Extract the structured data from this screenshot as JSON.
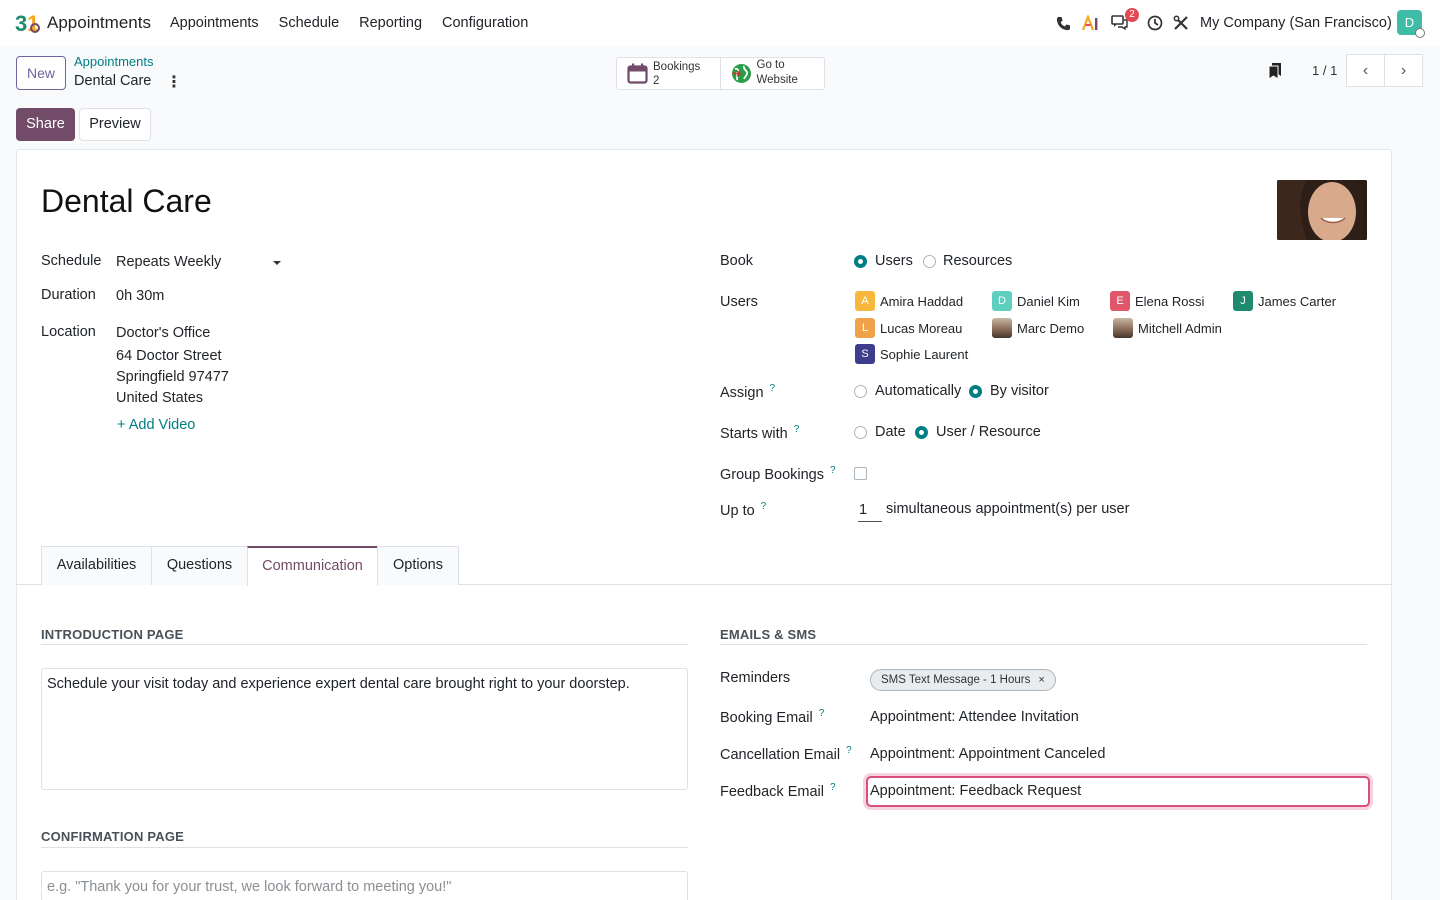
{
  "navbar": {
    "app_name": "Appointments",
    "menu": [
      "Appointments",
      "Schedule",
      "Reporting",
      "Configuration"
    ],
    "message_count": "2",
    "company": "My Company (San Francisco)",
    "user_initial": "D"
  },
  "control": {
    "new_label": "New",
    "breadcrumb_parent": "Appointments",
    "breadcrumb_current": "Dental Care",
    "bookings_label": "Bookings",
    "bookings_count": "2",
    "website_label_1": "Go to",
    "website_label_2": "Website",
    "pager": "1 / 1",
    "share_label": "Share",
    "preview_label": "Preview"
  },
  "form": {
    "title": "Dental Care",
    "schedule_label": "Schedule",
    "schedule_value": "Repeats Weekly",
    "duration_label": "Duration",
    "duration_value": "0h 30m",
    "location_label": "Location",
    "location_lines": [
      "Doctor's Office",
      "64 Doctor Street",
      "Springfield 97477",
      "United States"
    ],
    "add_video": "Add Video",
    "book_label": "Book",
    "book_options": [
      "Users",
      "Resources"
    ],
    "users_label": "Users",
    "users": [
      {
        "initial": "A",
        "name": "Amira Haddad",
        "color": "#f6b73c"
      },
      {
        "initial": "D",
        "name": "Daniel Kim",
        "color": "#5fcfc0"
      },
      {
        "initial": "E",
        "name": "Elena Rossi",
        "color": "#e0566a"
      },
      {
        "initial": "J",
        "name": "James Carter",
        "color": "#1e8a6e"
      },
      {
        "initial": "L",
        "name": "Lucas Moreau",
        "color": "#f0a24a"
      },
      {
        "initial": "",
        "name": "Marc Demo",
        "color": "photo"
      },
      {
        "initial": "",
        "name": "Mitchell Admin",
        "color": "photo"
      },
      {
        "initial": "S",
        "name": "Sophie Laurent",
        "color": "#3e3d8c"
      }
    ],
    "assign_label": "Assign",
    "assign_options": [
      "Automatically",
      "By visitor"
    ],
    "starts_label": "Starts with",
    "starts_options": [
      "Date",
      "User / Resource"
    ],
    "group_label": "Group Bookings",
    "upto_label": "Up to",
    "upto_value": "1",
    "upto_suffix": "simultaneous appointment(s) per user",
    "help": "?"
  },
  "tabs": [
    "Availabilities",
    "Questions",
    "Communication",
    "Options"
  ],
  "communication": {
    "intro_header": "INTRODUCTION PAGE",
    "intro_text": "Schedule your visit today and experience expert dental care brought right to your doorstep.",
    "confirm_header": "CONFIRMATION PAGE",
    "confirm_placeholder": "e.g. \"Thank you for your trust, we look forward to meeting you!\"",
    "emails_header": "EMAILS & SMS",
    "reminders_label": "Reminders",
    "reminder_tag": "SMS Text Message - 1 Hours",
    "booking_email_label": "Booking Email",
    "booking_email_value": "Appointment: Attendee Invitation",
    "cancel_email_label": "Cancellation Email",
    "cancel_email_value": "Appointment: Appointment Canceled",
    "feedback_email_label": "Feedback Email",
    "feedback_email_value": "Appointment: Feedback Request"
  }
}
